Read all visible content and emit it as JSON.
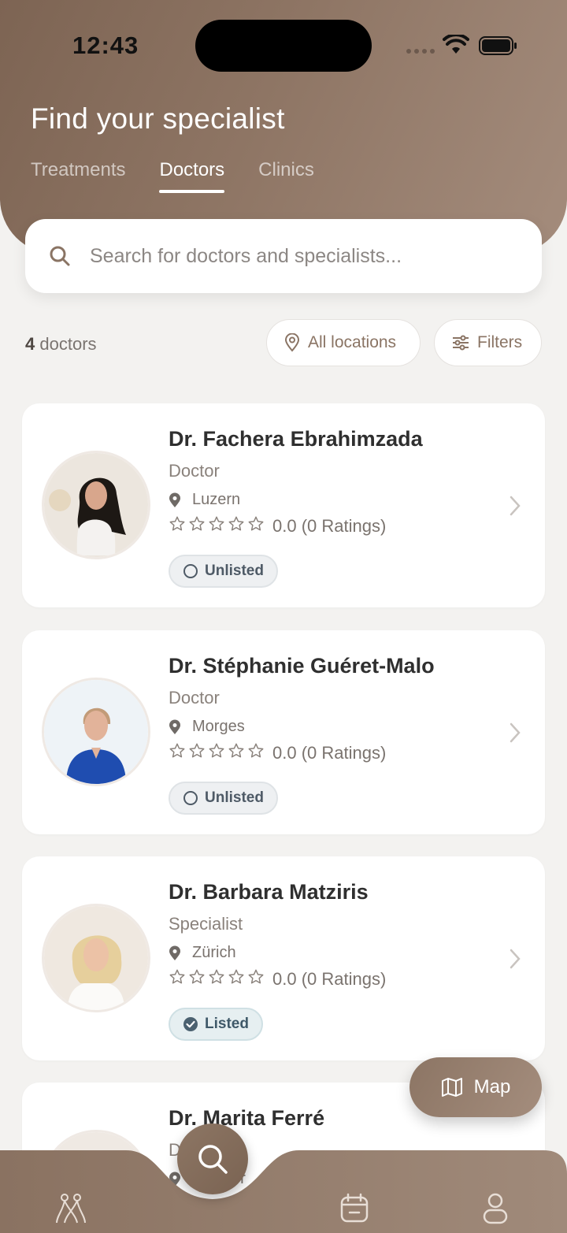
{
  "status_bar": {
    "time": "12:43"
  },
  "header": {
    "title": "Find your specialist",
    "tabs": [
      {
        "label": "Treatments",
        "active": false
      },
      {
        "label": "Doctors",
        "active": true
      },
      {
        "label": "Clinics",
        "active": false
      }
    ]
  },
  "search": {
    "placeholder": "Search for doctors and specialists...",
    "value": ""
  },
  "list_header": {
    "count": "4",
    "count_label": "doctors",
    "location_button": "All locations",
    "filters_button": "Filters"
  },
  "doctors": [
    {
      "name": "Dr. Fachera Ebrahimzada",
      "role": "Doctor",
      "location": "Luzern",
      "rating": "0.0 (0 Ratings)",
      "status": "Unlisted"
    },
    {
      "name": "Dr. Stéphanie Guéret-Malo",
      "role": "Doctor",
      "location": "Morges",
      "rating": "0.0 (0 Ratings)",
      "status": "Unlisted"
    },
    {
      "name": "Dr. Barbara Matziris",
      "role": "Specialist",
      "location": "Zürich",
      "rating": "0.0 (0 Ratings)",
      "status": "Listed"
    },
    {
      "name": "Dr. Marita Ferré",
      "role": "D",
      "location": "er"
    }
  ],
  "map_button": {
    "label": "Map"
  },
  "bottom_nav": {
    "items": [
      "home-icon",
      "search-icon",
      "calendar-icon",
      "profile-icon"
    ]
  },
  "colors": {
    "brand": "#8c7564",
    "background": "#f3f2f0",
    "listed_check": "#4b6170"
  }
}
